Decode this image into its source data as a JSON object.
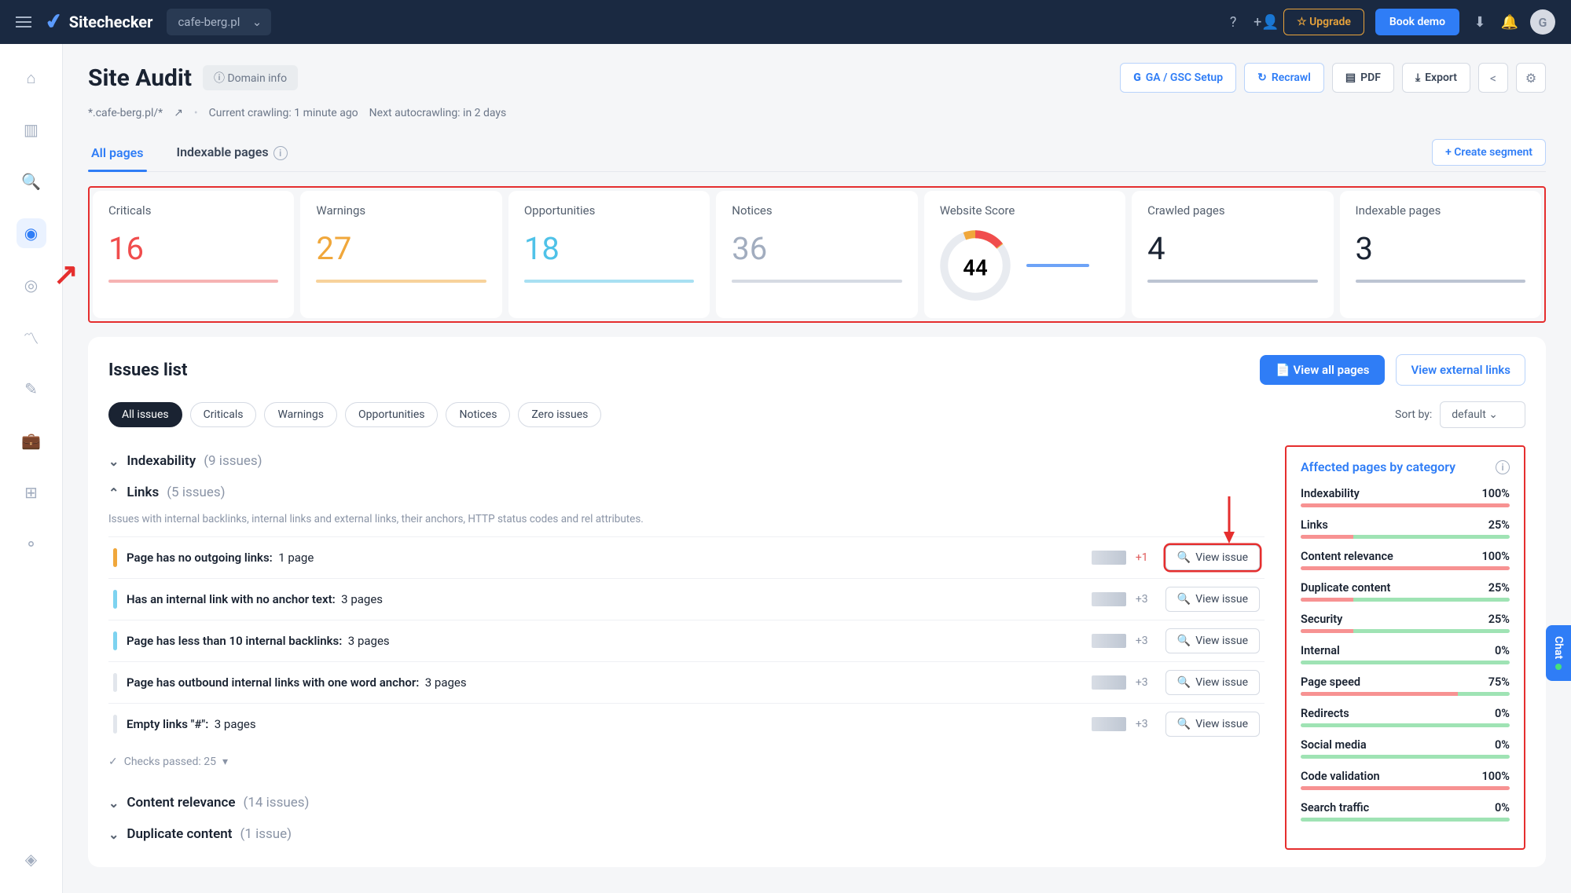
{
  "topnav": {
    "brand": "Sitechecker",
    "site": "cafe-berg.pl",
    "upgrade": "Upgrade",
    "demo": "Book demo",
    "avatar_initial": "G"
  },
  "header": {
    "title": "Site Audit",
    "domain_info": "Domain info",
    "crumb_domain": "*.cafe-berg.pl/*",
    "crumb_crawling": "Current crawling: 1 minute ago",
    "crumb_next": "Next autocrawling: in 2 days",
    "ga_gsc": "GA / GSC Setup",
    "recrawl": "Recrawl",
    "pdf": "PDF",
    "export": "Export"
  },
  "tabs": {
    "all_pages": "All pages",
    "indexable": "Indexable pages",
    "create_segment": "+  Create segment"
  },
  "metrics": {
    "criticals_label": "Criticals",
    "criticals_value": "16",
    "warnings_label": "Warnings",
    "warnings_value": "27",
    "opportunities_label": "Opportunities",
    "opportunities_value": "18",
    "notices_label": "Notices",
    "notices_value": "36",
    "score_label": "Website Score",
    "score_value": "44",
    "crawled_label": "Crawled pages",
    "crawled_value": "4",
    "indexable_label": "Indexable pages",
    "indexable_value": "3"
  },
  "panel": {
    "title": "Issues list",
    "view_all": "View all pages",
    "view_ext": "View external links",
    "sort_by": "Sort by:",
    "sort_value": "default"
  },
  "filters": {
    "all": "All issues",
    "crit": "Criticals",
    "warn": "Warnings",
    "opp": "Opportunities",
    "not": "Notices",
    "zero": "Zero issues"
  },
  "categories": {
    "indexability": "Indexability",
    "indexability_count": "(9 issues)",
    "links": "Links",
    "links_count": "(5 issues)",
    "links_desc": "Issues with internal backlinks, internal links and external links, their anchors, HTTP status codes and rel attributes.",
    "content_relevance": "Content relevance",
    "content_relevance_count": "(14 issues)",
    "duplicate": "Duplicate content",
    "duplicate_count": "(1 issue)"
  },
  "issues": {
    "i1_title": "Page has no outgoing links:",
    "i1_pages": "1 page",
    "i1_delta": "+1",
    "i2_title": "Has an internal link with no anchor text:",
    "i2_pages": "3 pages",
    "i2_delta": "+3",
    "i3_title": "Page has less than 10 internal backlinks:",
    "i3_pages": "3 pages",
    "i3_delta": "+3",
    "i4_title": "Page has outbound internal links with one word anchor:",
    "i4_pages": "3 pages",
    "i4_delta": "+3",
    "i5_title": "Empty links \"#\":",
    "i5_pages": "3 pages",
    "i5_delta": "+3",
    "view_issue": "View issue",
    "checks_passed": "Checks passed: 25"
  },
  "affected": {
    "title": "Affected pages by category",
    "rows": [
      {
        "label": "Indexability",
        "pct": "100%",
        "fill": 100
      },
      {
        "label": "Links",
        "pct": "25%",
        "fill": 25
      },
      {
        "label": "Content relevance",
        "pct": "100%",
        "fill": 100
      },
      {
        "label": "Duplicate content",
        "pct": "25%",
        "fill": 25
      },
      {
        "label": "Security",
        "pct": "25%",
        "fill": 25
      },
      {
        "label": "Internal",
        "pct": "0%",
        "fill": 0
      },
      {
        "label": "Page speed",
        "pct": "75%",
        "fill": 75
      },
      {
        "label": "Redirects",
        "pct": "0%",
        "fill": 0
      },
      {
        "label": "Social media",
        "pct": "0%",
        "fill": 0
      },
      {
        "label": "Code validation",
        "pct": "100%",
        "fill": 100
      },
      {
        "label": "Search traffic",
        "pct": "0%",
        "fill": 0
      }
    ]
  },
  "chat": "Chat"
}
